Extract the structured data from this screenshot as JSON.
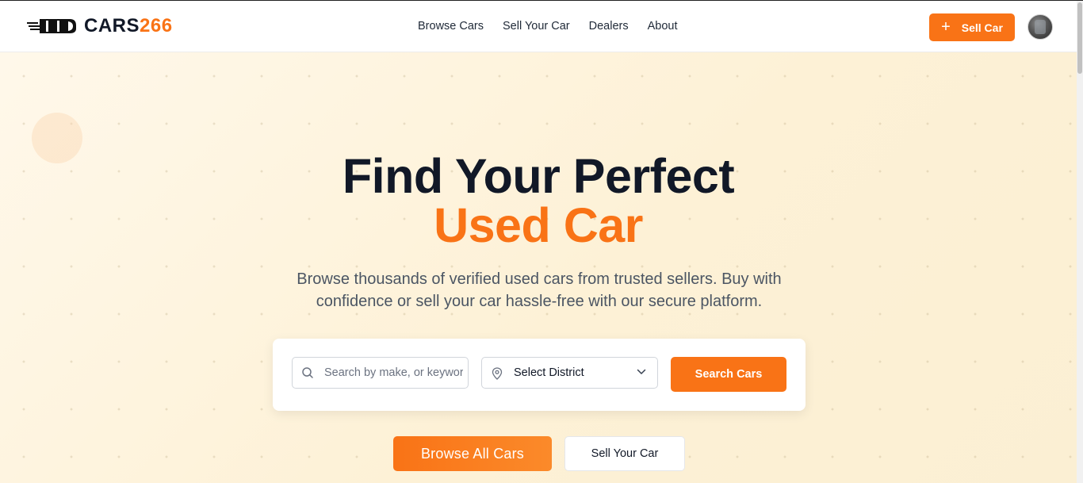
{
  "brand": {
    "name_part1": "CARS",
    "name_part2": "266",
    "accent_color": "#f97316",
    "icon": "car-speed-icon"
  },
  "nav": {
    "items": [
      {
        "label": "Browse Cars"
      },
      {
        "label": "Sell Your Car"
      },
      {
        "label": "Dealers"
      },
      {
        "label": "About"
      }
    ]
  },
  "header": {
    "sell_button_label": "Sell Car",
    "sell_button_icon": "plus-icon",
    "avatar_icon": "user-avatar"
  },
  "hero": {
    "title_line1": "Find Your Perfect",
    "title_line2": "Used Car",
    "subtitle": "Browse thousands of verified used cars from trusted sellers. Buy with confidence or sell your car hassle-free with our secure platform."
  },
  "search": {
    "placeholder": "Search by make, or keyword",
    "value": "",
    "district_label": "Select District",
    "button_label": "Search Cars"
  },
  "cta": {
    "browse_label": "Browse All Cars",
    "sell_label": "Sell Your Car"
  }
}
